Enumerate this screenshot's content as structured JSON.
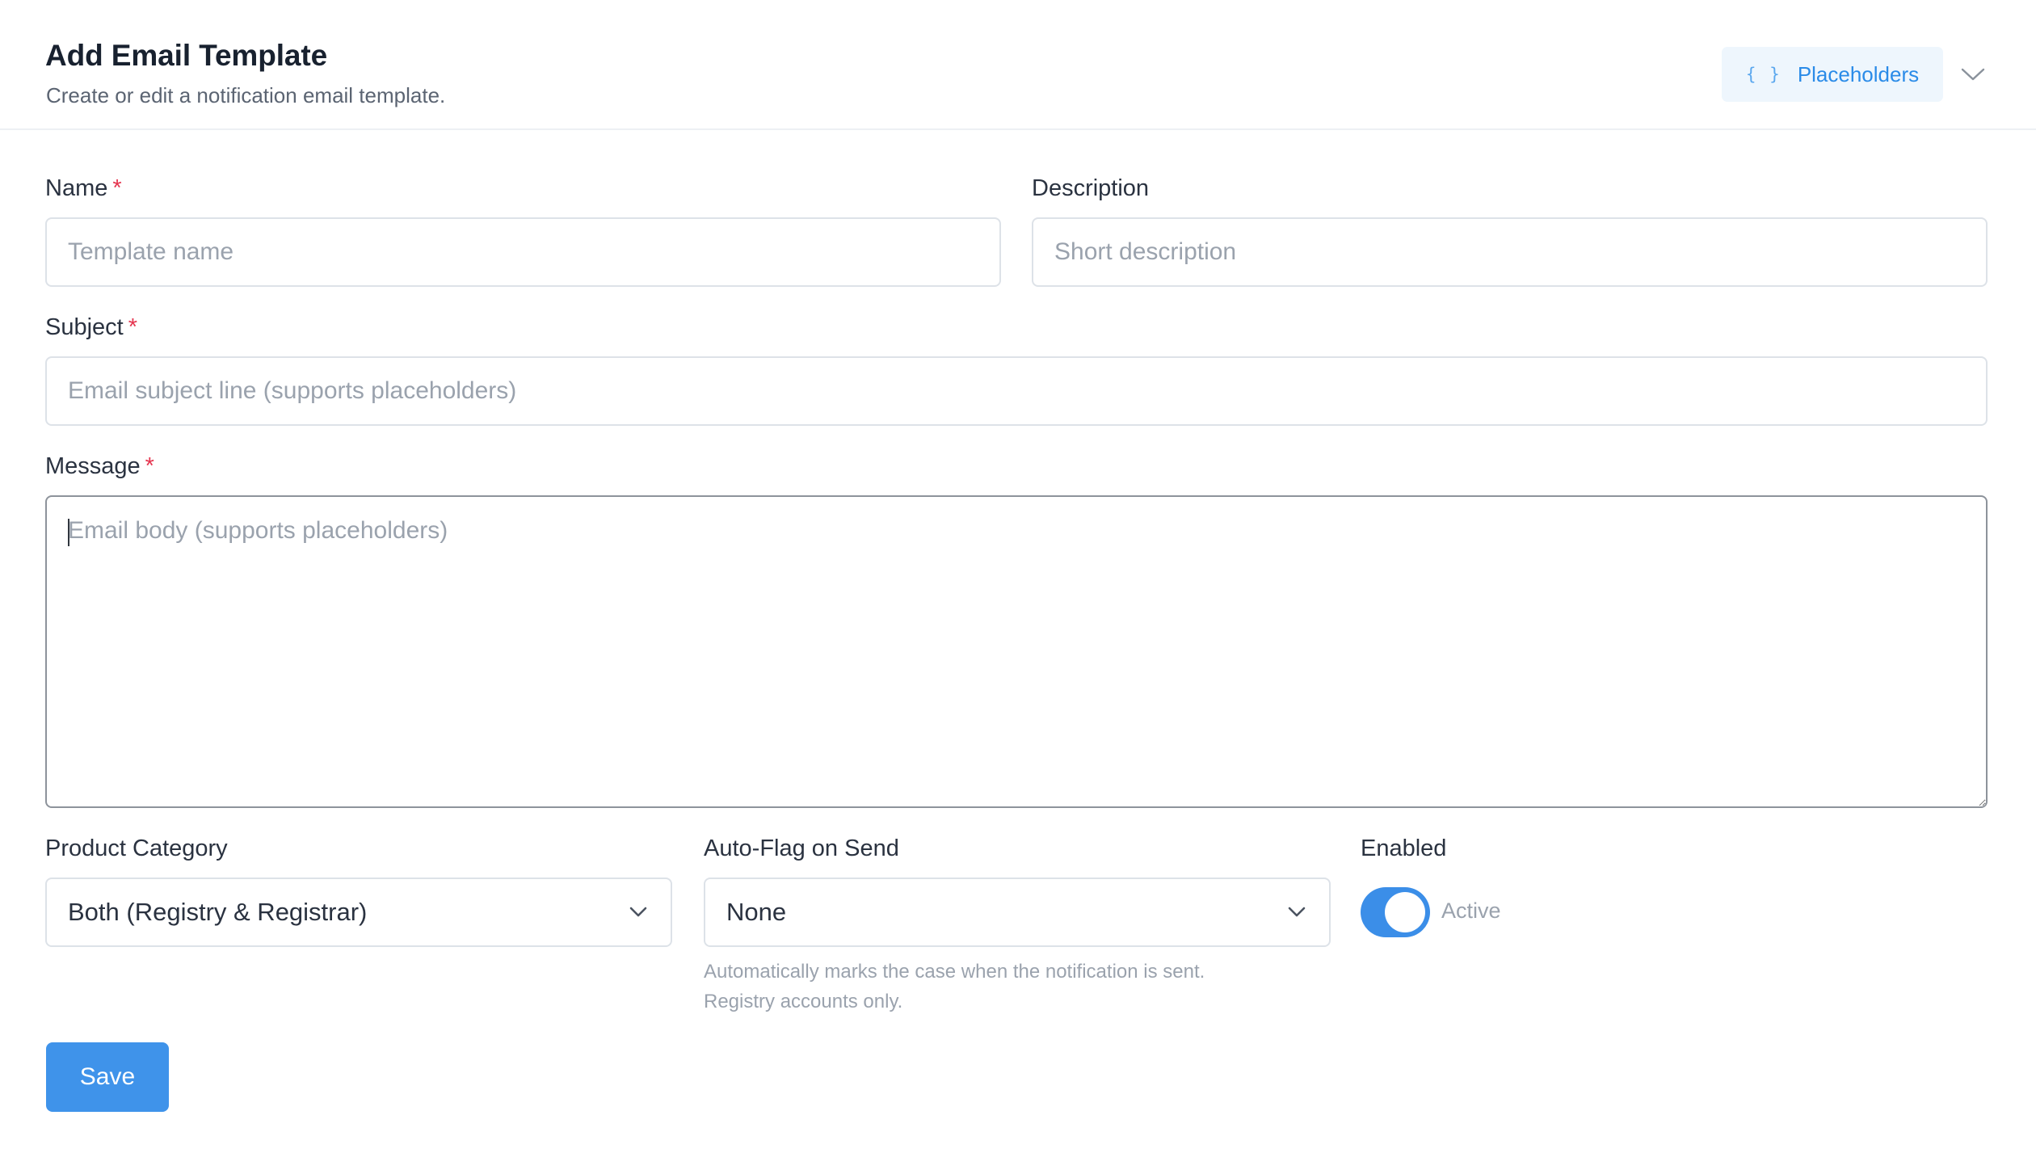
{
  "header": {
    "title": "Add Email Template",
    "subtitle": "Create or edit a notification email template.",
    "placeholders_button": {
      "icon_text": "{ }",
      "label": "Placeholders"
    },
    "collapse_icon": "chevron-down-icon"
  },
  "form": {
    "name": {
      "label": "Name",
      "required_mark": "*",
      "placeholder": "Template name",
      "value": ""
    },
    "description": {
      "label": "Description",
      "placeholder": "Short description",
      "value": ""
    },
    "subject": {
      "label": "Subject",
      "required_mark": "*",
      "placeholder": "Email subject line (supports placeholders)",
      "value": ""
    },
    "message": {
      "label": "Message",
      "required_mark": "*",
      "placeholder": "Email body (supports placeholders)",
      "value": ""
    },
    "product_category": {
      "label": "Product Category",
      "selected": "Both (Registry & Registrar)"
    },
    "auto_flag": {
      "label": "Auto-Flag on Send",
      "selected": "None",
      "help_line1": "Automatically marks the case when the notification is sent.",
      "help_line2": "Registry accounts only."
    },
    "enabled": {
      "label": "Enabled",
      "state": true,
      "state_label": "Active"
    },
    "save_label": "Save"
  },
  "colors": {
    "accent": "#3f93ea",
    "required": "#e5354f",
    "placeholder_text": "#9aa2ad",
    "placeholders_button_bg": "#eef6fd"
  }
}
